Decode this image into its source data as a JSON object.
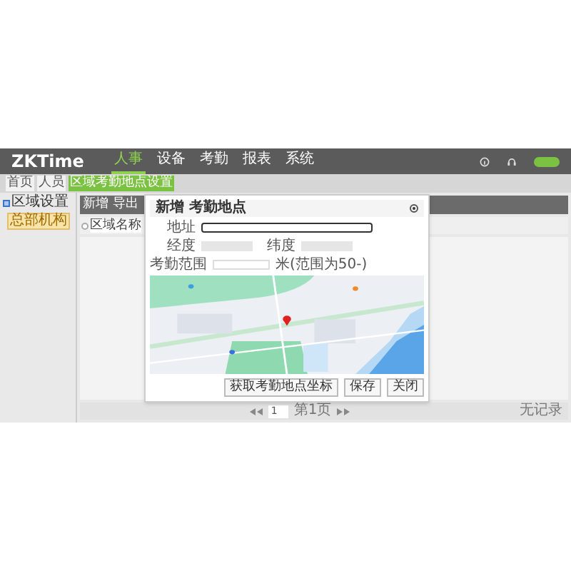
{
  "header": {
    "logo": "ZKTime",
    "nav": [
      {
        "label": "人事",
        "selected": true
      },
      {
        "label": "设备",
        "selected": false
      },
      {
        "label": "考勤",
        "selected": false
      },
      {
        "label": "报表",
        "selected": false
      },
      {
        "label": "系统",
        "selected": false
      }
    ]
  },
  "tabs": [
    {
      "label": "首页",
      "selected": false
    },
    {
      "label": "人员",
      "selected": false
    },
    {
      "label": "区域考勤地点设置",
      "selected": true
    }
  ],
  "sidebar": {
    "title": "区域设置",
    "tree": [
      {
        "label": "总部机构",
        "selected": true
      }
    ]
  },
  "toolbar": [
    "新增",
    "导出"
  ],
  "table": {
    "columns": [
      "区域名称"
    ]
  },
  "dialog": {
    "title": "新增 考勤地点",
    "address_label": "地址",
    "longitude_label": "经度",
    "latitude_label": "纬度",
    "range_label": "考勤范围",
    "range_hint": "米(范围为50-)",
    "buttons": [
      "获取考勤地点坐标",
      "保存",
      "关闭"
    ]
  },
  "pager": {
    "page": "1",
    "page_text": "第1页",
    "summary": "无记录"
  }
}
